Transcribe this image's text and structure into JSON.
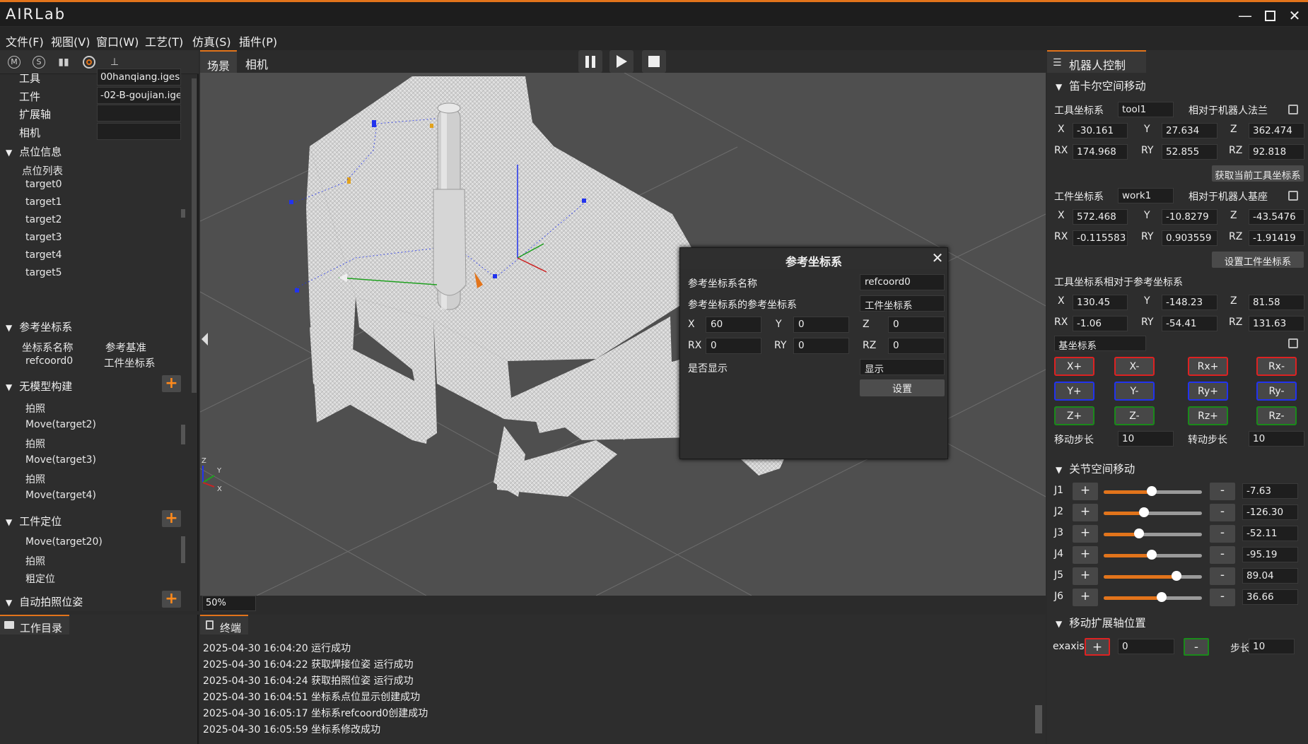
{
  "app": {
    "title": "AIRLab"
  },
  "menu": [
    "文件(F)",
    "视图(V)",
    "窗口(W)",
    "工艺(T)",
    "仿真(S)",
    "插件(P)"
  ],
  "left": {
    "fields": [
      {
        "label": "工具",
        "value": "00hanqiang.iges"
      },
      {
        "label": "工件",
        "value": "-02-B-goujian.iges"
      },
      {
        "label": "扩展轴",
        "value": ""
      },
      {
        "label": "相机",
        "value": ""
      }
    ],
    "point_section": "点位信息",
    "point_list_title": "点位列表",
    "points": [
      "target0",
      "target1",
      "target2",
      "target3",
      "target4",
      "target5"
    ],
    "ref_section": "参考坐标系",
    "ref_headers": [
      "坐标系名称",
      "参考基准"
    ],
    "ref_rows": [
      [
        "refcoord0",
        "工件坐标系"
      ]
    ],
    "nomodel_section": "无模型构建",
    "nomodel_items": [
      "拍照",
      "Move(target2)",
      "拍照",
      "Move(target3)",
      "拍照",
      "Move(target4)"
    ],
    "workpos_section": "工件定位",
    "workpos_items": [
      "Move(target20)",
      "拍照",
      "粗定位"
    ],
    "autophoto_section": "自动拍照位姿"
  },
  "view": {
    "tabs": [
      "场景",
      "相机"
    ],
    "zoom": "50%",
    "playback_progress": 0
  },
  "dialog": {
    "title": "参考坐标系",
    "name_label": "参考坐标系名称",
    "name_value": "refcoord0",
    "ref_label": "参考坐标系的参考坐标系",
    "ref_value": "工件坐标系",
    "x_label": "X",
    "x": "60",
    "y_label": "Y",
    "y": "0",
    "z_label": "Z",
    "z": "0",
    "rx_label": "RX",
    "rx": "0",
    "ry_label": "RY",
    "ry": "0",
    "rz_label": "RZ",
    "rz": "0",
    "show_label": "是否显示",
    "show_value": "显示",
    "set_button": "设置"
  },
  "bottom": {
    "workdir_tab": "工作目录",
    "terminal_tab": "终端",
    "logs": [
      "2025-04-30 16:04:20  运行成功",
      "2025-04-30 16:04:22  获取焊接位姿 运行成功",
      "2025-04-30 16:04:24 获取拍照位姿  运行成功",
      "2025-04-30 16:04:51 坐标系点位显示创建成功",
      "2025-04-30 16:05:17 坐标系refcoord0创建成功",
      "2025-04-30 16:05:59 坐标系修改成功"
    ]
  },
  "right": {
    "panel_title": "机器人控制",
    "cartesian_section": "笛卡尔空间移动",
    "tool_label": "工具坐标系",
    "tool_value": "tool1",
    "tool_rel": "相对于机器人法兰",
    "tool": {
      "x": "-30.161",
      "y": "27.634",
      "z": "362.474",
      "rx": "174.968",
      "ry": "52.855",
      "rz": "92.818"
    },
    "get_tool_button": "获取当前工具坐标系",
    "work_label": "工件坐标系",
    "work_value": "work1",
    "work_rel": "相对于机器人基座",
    "work": {
      "x": "572.468",
      "y": "-10.8279",
      "z": "-43.5476",
      "rx": "-0.115583",
      "ry": "0.903559",
      "rz": "-1.91419"
    },
    "set_work_button": "设置工件坐标系",
    "tool_ref_title": "工具坐标系相对于参考坐标系",
    "toolref": {
      "x": "130.45",
      "y": "-148.23",
      "z": "81.58",
      "rx": "-1.06",
      "ry": "-54.41",
      "rz": "131.63"
    },
    "axis_labels": {
      "x": "X",
      "y": "Y",
      "z": "Z",
      "rx": "RX",
      "ry": "RY",
      "rz": "RZ"
    },
    "base_select": "基坐标系",
    "jog": [
      [
        "X+",
        "X-",
        "Rx+",
        "Rx-"
      ],
      [
        "Y+",
        "Y-",
        "Ry+",
        "Ry-"
      ],
      [
        "Z+",
        "Z-",
        "Rz+",
        "Rz-"
      ]
    ],
    "move_step_label": "移动步长",
    "move_step": "10",
    "rot_step_label": "转动步长",
    "rot_step": "10",
    "joint_section": "关节空间移动",
    "joints": [
      {
        "name": "J1",
        "value": "-7.63",
        "pos": 0.49
      },
      {
        "name": "J2",
        "value": "-126.30",
        "pos": 0.41
      },
      {
        "name": "J3",
        "value": "-52.11",
        "pos": 0.36
      },
      {
        "name": "J4",
        "value": "-95.19",
        "pos": 0.49
      },
      {
        "name": "J5",
        "value": "89.04",
        "pos": 0.74
      },
      {
        "name": "J6",
        "value": "36.66",
        "pos": 0.59
      }
    ],
    "plus": "+",
    "minus": "-",
    "exaxis_section": "移动扩展轴位置",
    "exaxis_label": "exaxis",
    "exaxis_value": "0",
    "exaxis_step_label": "步长",
    "exaxis_step": "10"
  },
  "colors": {
    "accent": "#e2741b",
    "red": "#dd2222",
    "blue": "#2233ee",
    "green": "#1a8a1a"
  }
}
